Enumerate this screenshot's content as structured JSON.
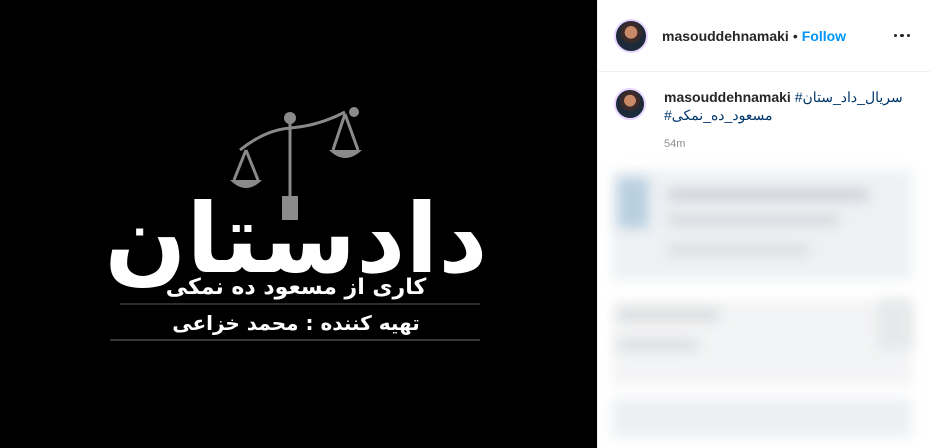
{
  "post": {
    "username": "masouddehnamaki",
    "separator": "•",
    "follow_label": "Follow",
    "caption_username": "masouddehnamaki",
    "hashtag_1": "#سریال_داد_ستان",
    "hashtag_2": "#مسعود_ده_نمکی",
    "time_ago": "54m"
  },
  "poster": {
    "title": "دادستان",
    "subtitle": "کاری از مسعود ده نمکی",
    "producer": "تهیه کننده : محمد خزاعی",
    "background": "#000000"
  },
  "colors": {
    "follow": "#0095f6",
    "hashtag": "#00376b"
  }
}
